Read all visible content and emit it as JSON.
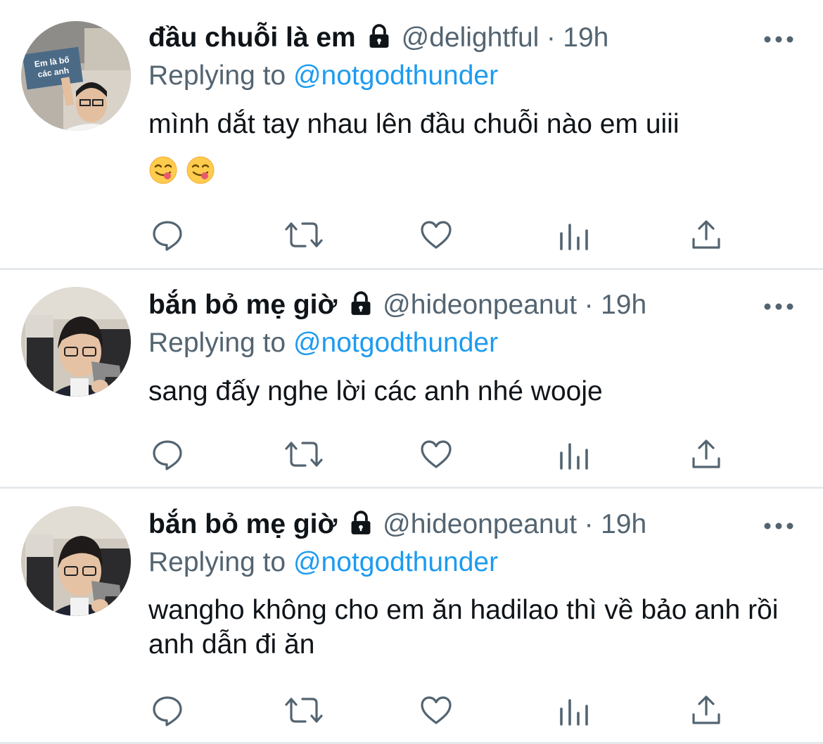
{
  "tweets": [
    {
      "name": "đầu chuỗi là em",
      "handle": "@delightful",
      "separator": "·",
      "time": "19h",
      "replying_prefix": "Replying to ",
      "replying_to": "@notgodthunder",
      "text": "mình dắt tay nhau lên đầu chuỗi nào em uiii",
      "emojis": [
        "😋",
        "😋"
      ],
      "avatar_sign_text": "Em là bố các anh"
    },
    {
      "name": "bắn bỏ mẹ giờ",
      "handle": "@hideonpeanut",
      "separator": "·",
      "time": "19h",
      "replying_prefix": "Replying to ",
      "replying_to": "@notgodthunder",
      "text": "sang đấy nghe lời các anh nhé wooje"
    },
    {
      "name": "bắn bỏ mẹ giờ",
      "handle": "@hideonpeanut",
      "separator": "·",
      "time": "19h",
      "replying_prefix": "Replying to ",
      "replying_to": "@notgodthunder",
      "text": "wangho không cho em ăn hadilao thì về bảo anh rồi anh dẫn đi ăn"
    }
  ],
  "icons": {
    "reply": "reply-icon",
    "retweet": "retweet-icon",
    "like": "heart-icon",
    "views": "analytics-icon",
    "share": "share-icon",
    "more": "more-icon",
    "lock": "lock-icon"
  },
  "colors": {
    "text": "#0f1419",
    "secondary": "#536471",
    "mention": "#1d9bf0",
    "divider": "#e6e9ec"
  }
}
